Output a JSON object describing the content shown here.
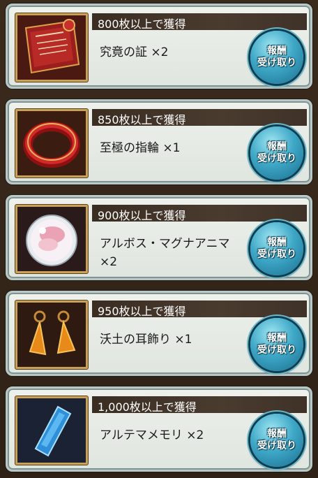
{
  "rewards": [
    {
      "header": "800枚以上で獲得",
      "item": "究竟の証 ×2",
      "icon": "scroll-icon",
      "btn_line1": "報酬",
      "btn_line2": "受け取り"
    },
    {
      "header": "850枚以上で獲得",
      "item": "至極の指輪 ×1",
      "icon": "ring-icon",
      "btn_line1": "報酬",
      "btn_line2": "受け取り"
    },
    {
      "header": "900枚以上で獲得",
      "item": "アルボス・マグナアニマ ×2",
      "icon": "orb-icon",
      "btn_line1": "報酬",
      "btn_line2": "受け取り"
    },
    {
      "header": "950枚以上で獲得",
      "item": "沃土の耳飾り ×1",
      "icon": "earrings-icon",
      "btn_line1": "報酬",
      "btn_line2": "受け取り"
    },
    {
      "header": "1,000枚以上で獲得",
      "item": "アルテマメモリ ×2",
      "icon": "crystal-shard-icon",
      "btn_line1": "報酬",
      "btn_line2": "受け取り"
    }
  ],
  "colors": {
    "button": "#3fa8c7",
    "header_bar": "#3a2d22",
    "card": "#e6eae4"
  }
}
